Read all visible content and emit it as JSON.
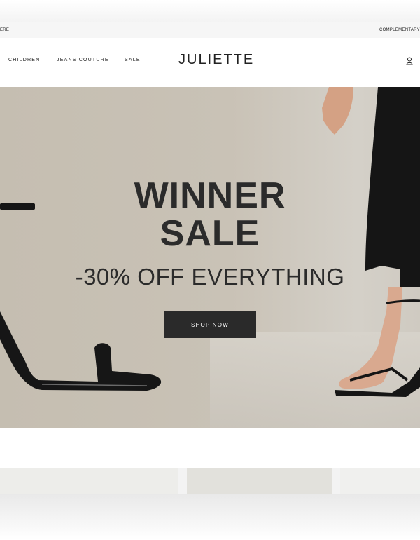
{
  "topbar": {
    "left_text": "ere",
    "right_text": "COMPLEMENTARY"
  },
  "nav": {
    "items": [
      {
        "label": "CHILDREN"
      },
      {
        "label": "JEANS COUTURE"
      },
      {
        "label": "SALE"
      }
    ]
  },
  "brand": {
    "logo": "JULIETTE"
  },
  "hero": {
    "title_line1": "WINNER",
    "title_line2": "SALE",
    "subtitle": "-30% OFF EVERYTHING",
    "cta_label": "SHOP NOW"
  },
  "colors": {
    "hero_bg": "#c5beb1",
    "button_bg": "#2a2a2a",
    "text": "#2b2b2b"
  },
  "icons": {
    "account": "user-icon"
  }
}
